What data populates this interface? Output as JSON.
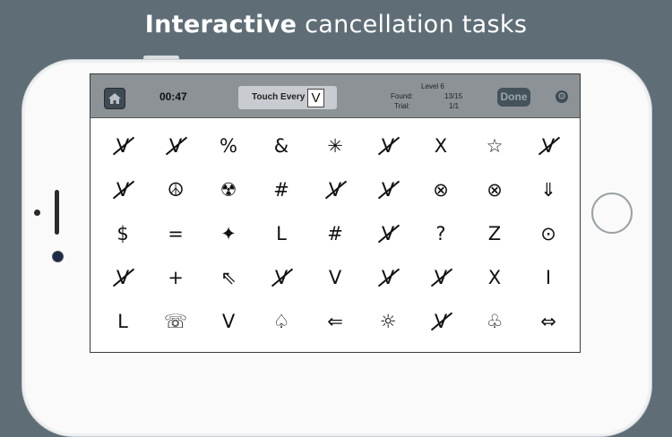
{
  "headline": {
    "bold": "Interactive",
    "rest": " cancellation tasks"
  },
  "topbar": {
    "timer": "00:47",
    "touch_label": "Touch Every",
    "touch_target": "V",
    "level": "Level 6",
    "found_label": "Found:",
    "found_value": "13/15",
    "trial_label": "Trial:",
    "trial_value": "1/1",
    "done_label": "Done"
  },
  "grid": {
    "rows": [
      [
        {
          "s": "V",
          "x": true
        },
        {
          "s": "V",
          "x": true
        },
        {
          "s": "%"
        },
        {
          "s": "&"
        },
        {
          "s": "✳"
        },
        {
          "s": "V",
          "x": true
        },
        {
          "s": "X"
        },
        {
          "s": "☆"
        },
        {
          "s": "V",
          "x": true
        }
      ],
      [
        {
          "s": "V",
          "x": true
        },
        {
          "s": "☮"
        },
        {
          "s": "☢"
        },
        {
          "s": "#"
        },
        {
          "s": "V",
          "x": true
        },
        {
          "s": "V",
          "x": true
        },
        {
          "s": "⊗"
        },
        {
          "s": "⊗"
        },
        {
          "s": "⇓"
        }
      ],
      [
        {
          "s": "$"
        },
        {
          "s": "="
        },
        {
          "s": "✦"
        },
        {
          "s": "L"
        },
        {
          "s": "#"
        },
        {
          "s": "V",
          "x": true
        },
        {
          "s": "?"
        },
        {
          "s": "Z"
        },
        {
          "s": "⊙"
        }
      ],
      [
        {
          "s": "V",
          "x": true
        },
        {
          "s": "+"
        },
        {
          "s": "⇖"
        },
        {
          "s": "V",
          "x": true
        },
        {
          "s": "V"
        },
        {
          "s": "V",
          "x": true
        },
        {
          "s": "V",
          "x": true
        },
        {
          "s": "X"
        },
        {
          "s": "I"
        }
      ],
      [
        {
          "s": "L"
        },
        {
          "s": "☏"
        },
        {
          "s": "V"
        },
        {
          "s": "♤"
        },
        {
          "s": "⇐"
        },
        {
          "s": "☼"
        },
        {
          "s": "V",
          "x": true
        },
        {
          "s": "♧"
        },
        {
          "s": "⇔"
        }
      ]
    ]
  },
  "colors": {
    "background": "#5f6e76",
    "topbar": "#8d9297",
    "done": "#46525b"
  },
  "icons": {
    "home": "home-icon",
    "settings": "gear-icon"
  }
}
